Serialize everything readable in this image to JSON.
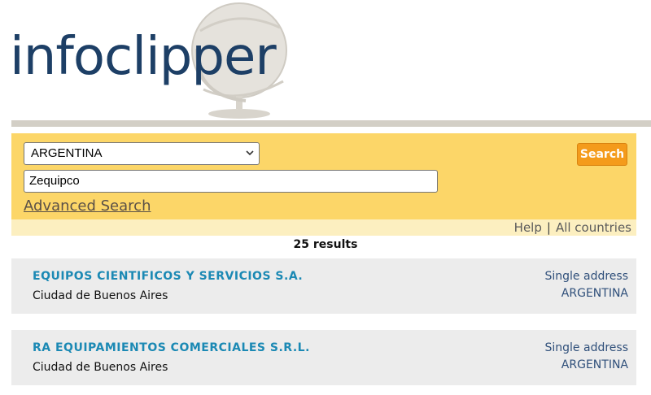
{
  "brand": {
    "logo_text": "infoclipper"
  },
  "search": {
    "country_selected": "ARGENTINA",
    "query_value": "Zequipco",
    "advanced_label": "Advanced Search",
    "search_button_label": "Search"
  },
  "help": {
    "help_label": "Help",
    "separator": "|",
    "all_countries_label": "All countries"
  },
  "results": {
    "count_label": "25 results",
    "items": [
      {
        "name": "EQUIPOS CIENTIFICOS Y SERVICIOS S.A.",
        "city": "Ciudad de Buenos Aires",
        "address_type": "Single address",
        "country": "ARGENTINA"
      },
      {
        "name": "RA EQUIPAMIENTOS COMERCIALES S.R.L.",
        "city": "Ciudad de Buenos Aires",
        "address_type": "Single address",
        "country": "ARGENTINA"
      }
    ]
  },
  "colors": {
    "panel": "#fcd668",
    "button": "#f49b1b",
    "result_name": "#1b89b4",
    "logo": "#1d3f66"
  },
  "icons": [
    "globe-logo-icon",
    "chevron-down-icon"
  ]
}
